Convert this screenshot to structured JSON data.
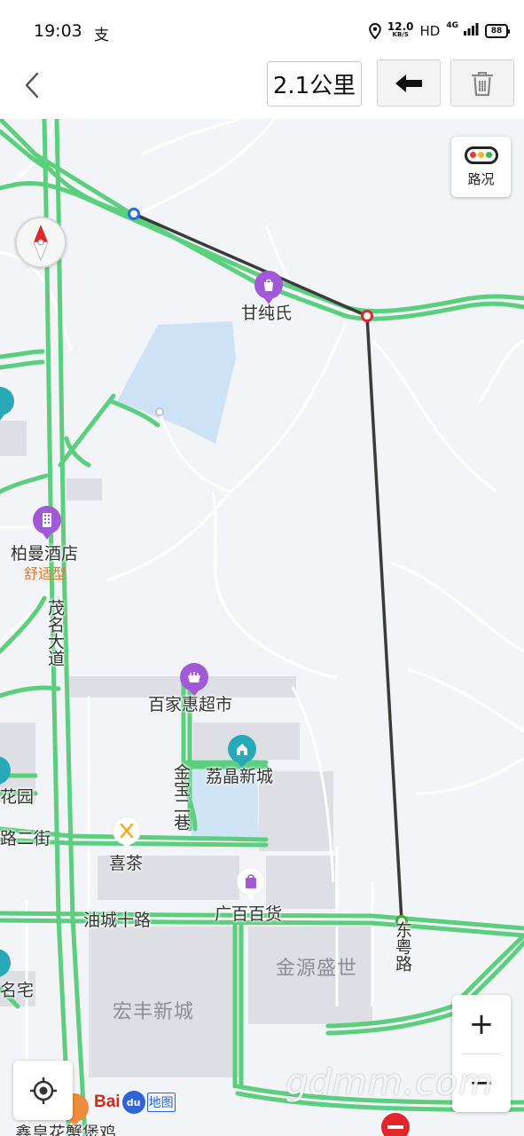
{
  "status_bar": {
    "time": "19:03",
    "notification_glyph": "支",
    "net_speed_value": "12.0",
    "net_speed_unit": "KB/S",
    "hd_label": "HD",
    "network_label": "4G",
    "battery": "88"
  },
  "toolbar": {
    "distance": "2.1公里"
  },
  "map": {
    "traffic_button_label": "路况",
    "traffic_colors": [
      "#e2403a",
      "#f6b624",
      "#3cb44f"
    ],
    "poi": {
      "ganchunshi": "甘纯氏",
      "boman_hotel": "柏曼酒店",
      "boman_hotel_tag": "舒适型",
      "baijiahui": "百家惠超市",
      "lijing": "荔晶新城",
      "xicha": "喜茶",
      "guangbai": "广百百货",
      "jinyuan": "金源盛世",
      "hongfeng": "宏丰新城",
      "huayuan_partial": "花园",
      "mingzhai_partial": "名宅",
      "xinhuang_partial": "鑫皇花蟹煲鸡"
    },
    "roads": {
      "maoming_avenue": "茂名大道",
      "jinbao_lane": "金宝二巷",
      "youcheng_road": "油城十路",
      "dongyue_road": "东粤路",
      "road_2nd_street_partial": "路二街"
    },
    "route_points_count": 4,
    "brand": {
      "bai": "Bai",
      "du": "du",
      "ditu": "地图"
    },
    "watermark": "gdmm.com",
    "zoom_in_label": "+",
    "zoom_out_label": "−"
  },
  "colors": {
    "road_green": "#5ccf7e",
    "route_line": "#3b3b3b",
    "start_point": "#1e6fe8",
    "mid_point": "#e0262b",
    "end_point": "#3aae2a",
    "poi_purple": "#a259d8",
    "poi_teal": "#28a9b8",
    "poi_orange": "#f5a623",
    "water": "#cde3f5"
  }
}
